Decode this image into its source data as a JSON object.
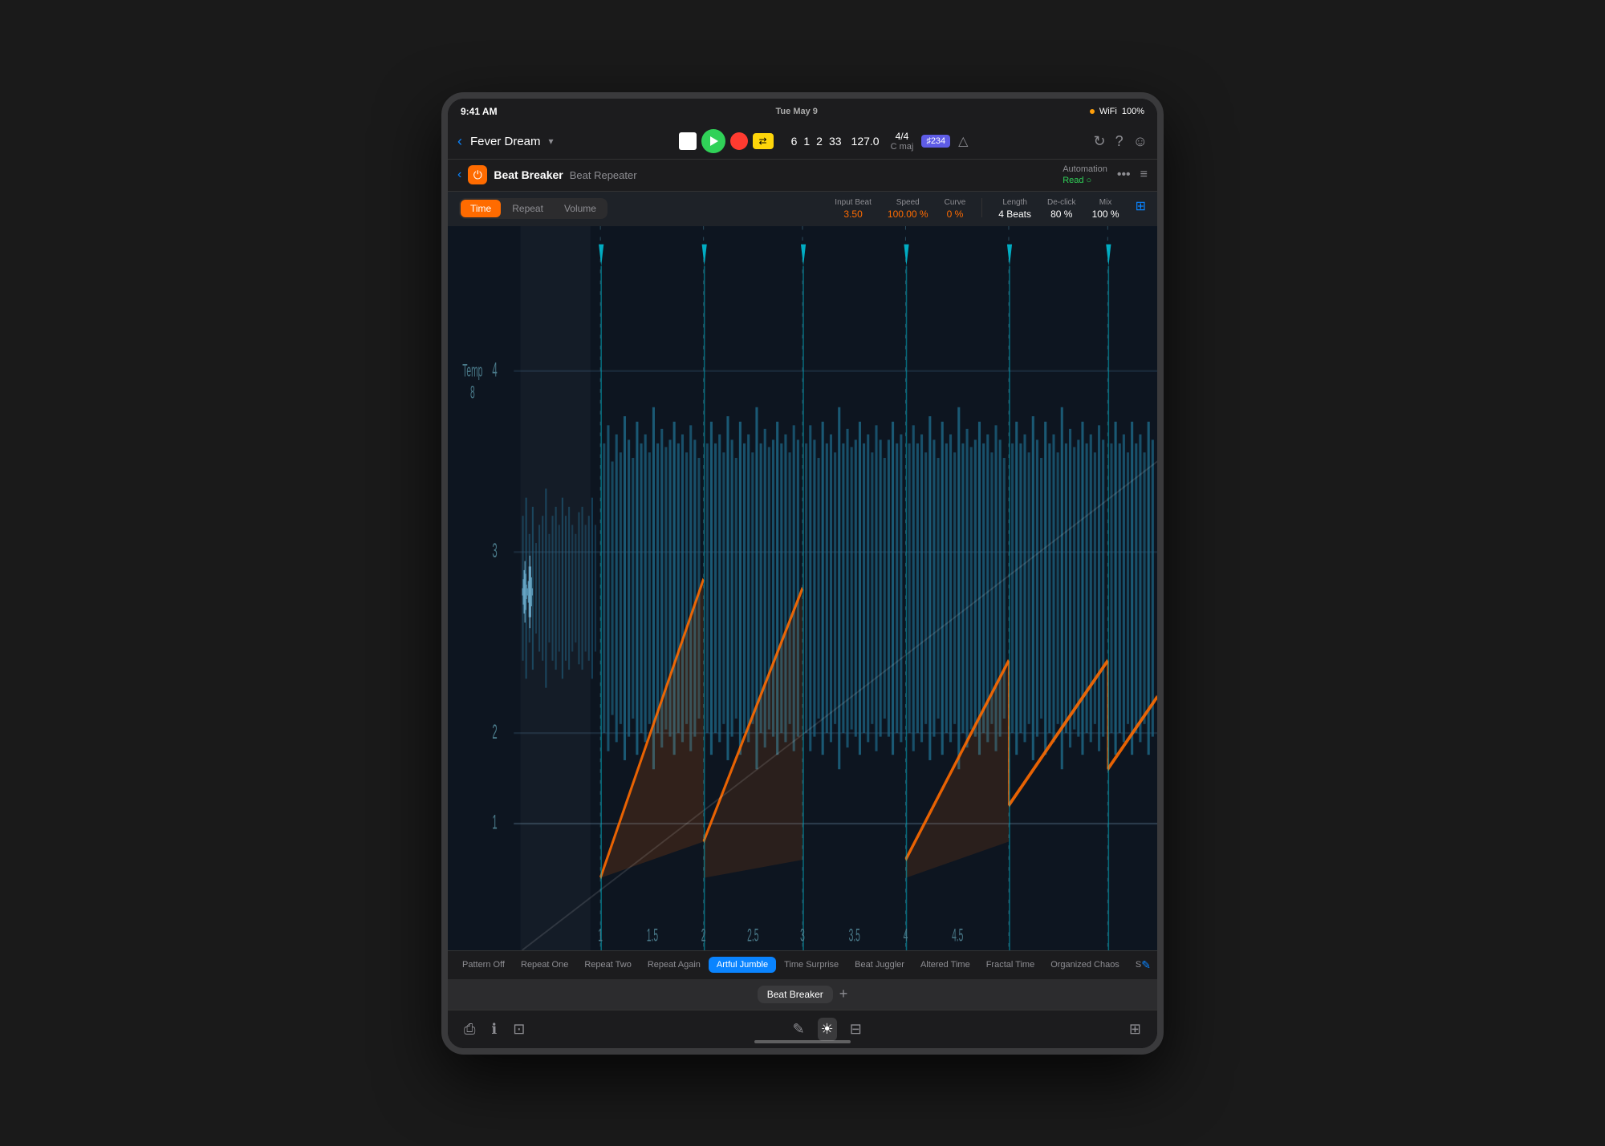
{
  "device": {
    "time": "9:41 AM",
    "date": "Tue May 9",
    "battery": "100%",
    "signal": "●●●"
  },
  "transport": {
    "back_label": "‹",
    "project_name": "Fever Dream",
    "chevron": "›",
    "stop_label": "■",
    "play_label": "▶",
    "record_label": "●",
    "cycle_label": "⇄",
    "position": "6",
    "bar": "1",
    "beat": "2",
    "tick": "33",
    "tempo": "127.0",
    "time_sig_top": "4/4",
    "time_sig_bottom": "C maj",
    "chord_badge": "♯234",
    "tuner_icon": "△",
    "icon1": "↻",
    "icon2": "?",
    "icon3": "☺"
  },
  "plugin_header": {
    "back": "‹",
    "plugin_name": "Beat Breaker",
    "plugin_type": "Beat Repeater",
    "automation_label": "Automation",
    "automation_value": "Read ○",
    "more": "•••",
    "lines": "≡"
  },
  "controls": {
    "tab_time": "Time",
    "tab_repeat": "Repeat",
    "tab_volume": "Volume",
    "param_input_beat_label": "Input Beat",
    "param_input_beat_value": "3.50",
    "param_speed_label": "Speed",
    "param_speed_value": "100.00 %",
    "param_curve_label": "Curve",
    "param_curve_value": "0 %",
    "param_length_label": "Length",
    "param_length_value": "4 Beats",
    "param_declick_label": "De-click",
    "param_declick_value": "80 %",
    "param_mix_label": "Mix",
    "param_mix_value": "100 %"
  },
  "presets": [
    {
      "label": "Pattern Off",
      "active": false
    },
    {
      "label": "Repeat One",
      "active": false
    },
    {
      "label": "Repeat Two",
      "active": false
    },
    {
      "label": "Repeat Again",
      "active": false
    },
    {
      "label": "Artful Jumble",
      "active": true
    },
    {
      "label": "Time Surprise",
      "active": false
    },
    {
      "label": "Beat Juggler",
      "active": false
    },
    {
      "label": "Altered Time",
      "active": false
    },
    {
      "label": "Fractal Time",
      "active": false
    },
    {
      "label": "Organized Chaos",
      "active": false
    },
    {
      "label": "Scattered Time",
      "active": false
    }
  ],
  "plugin_selector": {
    "badge_label": "Beat Breaker",
    "add_label": "+"
  },
  "bottom_toolbar": {
    "icon1": "⎙",
    "icon2": "ⓘ",
    "icon3": "⊞",
    "pencil": "✎",
    "brightness": "☀",
    "mixer": "⊟",
    "piano": "⊞"
  }
}
